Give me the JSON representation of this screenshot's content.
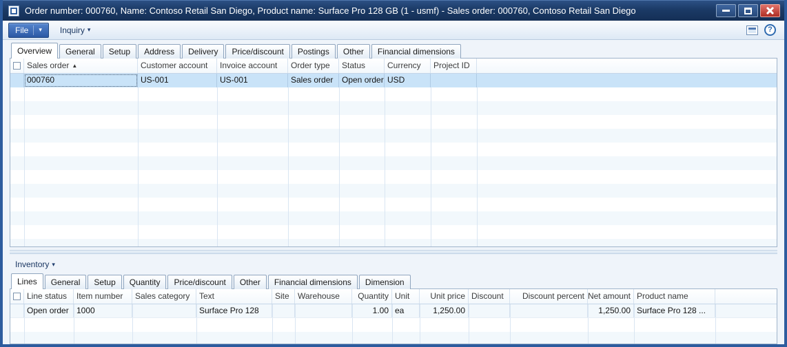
{
  "window": {
    "title": "Order number: 000760, Name: Contoso Retail San Diego, Product name: Surface Pro 128 GB (1 - usmf) - Sales order: 000760, Contoso Retail San Diego"
  },
  "menubar": {
    "file": "File",
    "inquiry": "Inquiry"
  },
  "main_tabs": [
    "Overview",
    "General",
    "Setup",
    "Address",
    "Delivery",
    "Price/discount",
    "Postings",
    "Other",
    "Financial dimensions"
  ],
  "orders_grid": {
    "columns": [
      "Sales order",
      "Customer account",
      "Invoice account",
      "Order type",
      "Status",
      "Currency",
      "Project ID"
    ],
    "sort_column": "Sales order",
    "sort_direction": "ascending",
    "row": {
      "sales_order": "000760",
      "customer_account": "US-001",
      "invoice_account": "US-001",
      "order_type": "Sales order",
      "status": "Open order",
      "currency": "USD",
      "project_id": ""
    }
  },
  "lines_pane": {
    "menu": "Inventory",
    "tabs": [
      "Lines",
      "General",
      "Setup",
      "Quantity",
      "Price/discount",
      "Other",
      "Financial dimensions",
      "Dimension"
    ],
    "columns": [
      "Line status",
      "Item number",
      "Sales category",
      "Text",
      "Site",
      "Warehouse",
      "Quantity",
      "Unit",
      "Unit price",
      "Discount",
      "Discount percent",
      "Net amount",
      "Product name"
    ],
    "row": {
      "line_status": "Open order",
      "item_number": "1000",
      "sales_category": "",
      "text": "Surface Pro 128",
      "site": "",
      "warehouse": "",
      "quantity": "1.00",
      "unit": "ea",
      "unit_price": "1,250.00",
      "discount": "",
      "discount_percent": "",
      "net_amount": "1,250.00",
      "product_name": "Surface Pro 128 ..."
    }
  },
  "icons": {
    "caret": "▾",
    "sort_asc": "▲",
    "help": "?"
  },
  "colors": {
    "titlebar": "#1B3A66",
    "window_border": "#2D5C9E",
    "close_button": "#BE3A34",
    "file_button": "#2E5CA6",
    "selected_row": "#C9E3F8"
  }
}
